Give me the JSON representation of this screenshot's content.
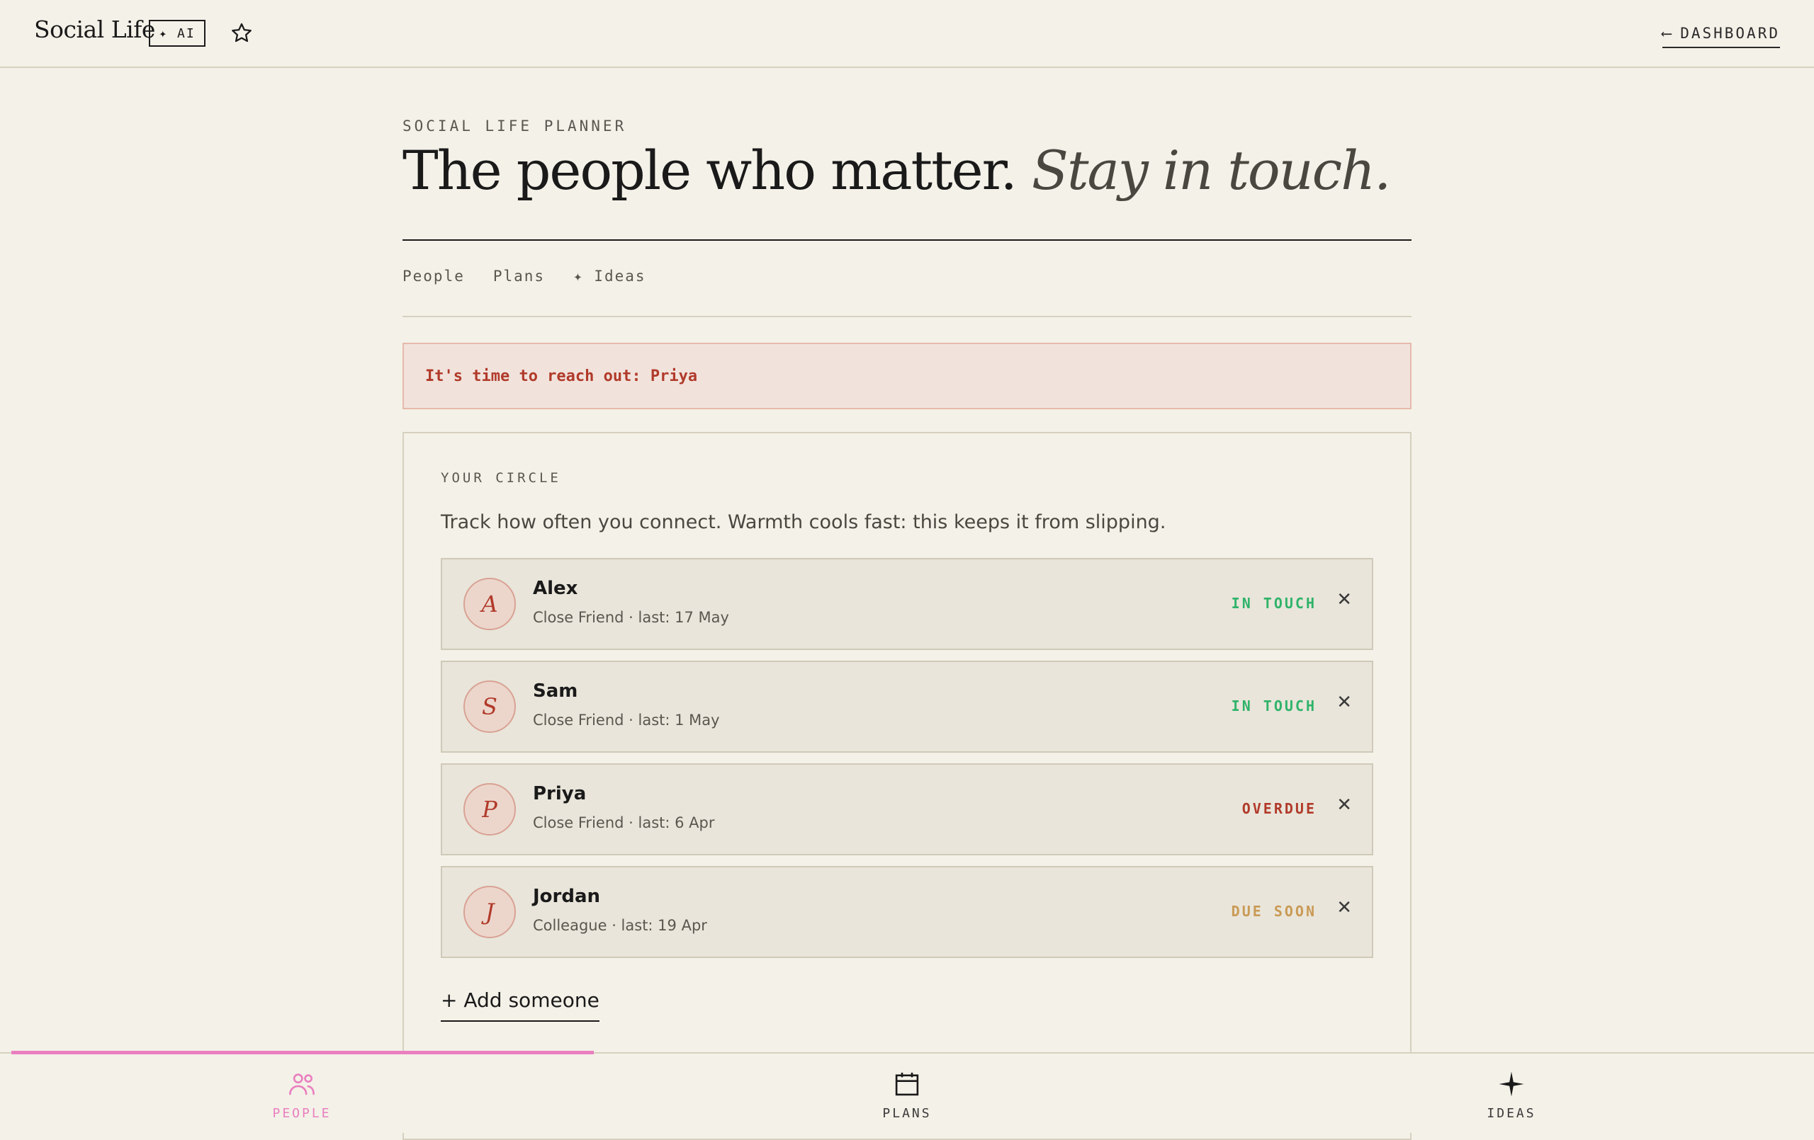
{
  "header": {
    "brand": "Social Life",
    "ai_badge": "✦ AI",
    "star_icon": "star-outline-icon",
    "dashboard_arrow": "⟵",
    "dashboard_label": "DASHBOARD"
  },
  "page": {
    "eyebrow": "SOCIAL LIFE PLANNER",
    "headline_main": "The people who matter.",
    "headline_italic": "Stay in touch."
  },
  "tabs": [
    {
      "label": "People"
    },
    {
      "label": "Plans"
    },
    {
      "label": "✦ Ideas"
    }
  ],
  "alert": {
    "text": "It's time to reach out: Priya",
    "color": "#b13a2a"
  },
  "circle": {
    "label": "YOUR CIRCLE",
    "description": "Track how often you connect. Warmth cools fast: this keeps it from slipping.",
    "people": [
      {
        "initial": "A",
        "name": "Alex",
        "meta": "Close Friend · last: 17 May",
        "status": "IN TOUCH",
        "status_color": "#2fb36a",
        "remove": "✕"
      },
      {
        "initial": "S",
        "name": "Sam",
        "meta": "Close Friend · last: 1 May",
        "status": "IN TOUCH",
        "status_color": "#2fb36a",
        "remove": "✕"
      },
      {
        "initial": "P",
        "name": "Priya",
        "meta": "Close Friend · last: 6 Apr",
        "status": "OVERDUE",
        "status_color": "#b13a2a",
        "remove": "✕"
      },
      {
        "initial": "J",
        "name": "Jordan",
        "meta": "Colleague · last: 19 Apr",
        "status": "DUE SOON",
        "status_color": "#c99a55",
        "remove": "✕"
      }
    ],
    "add_label": "+ Add someone"
  },
  "bottom_nav": {
    "active_color": "#e97fbf",
    "items": [
      {
        "label": "PEOPLE",
        "icon": "people-icon",
        "active": true
      },
      {
        "label": "PLANS",
        "icon": "calendar-icon",
        "active": false
      },
      {
        "label": "IDEAS",
        "icon": "sparkle-icon",
        "active": false
      }
    ]
  }
}
